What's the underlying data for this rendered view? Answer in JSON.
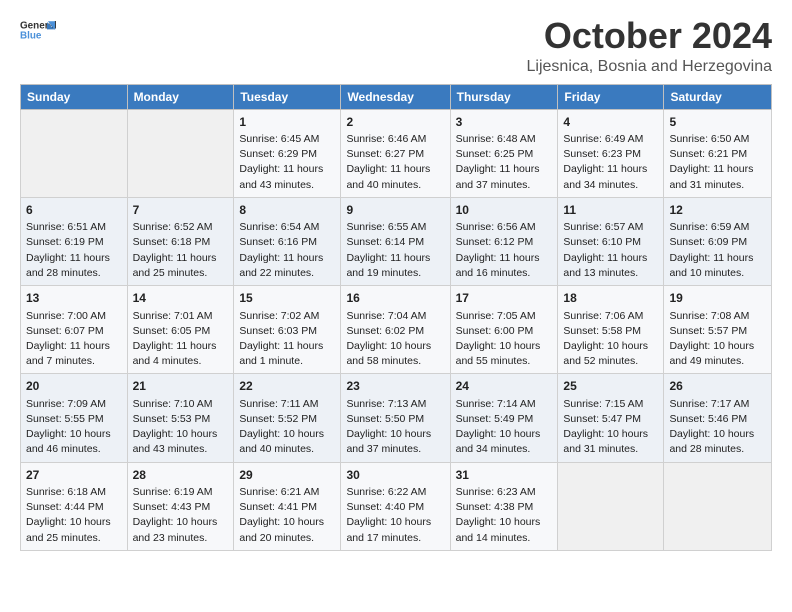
{
  "header": {
    "logo_general": "General",
    "logo_blue": "Blue",
    "month": "October 2024",
    "location": "Lijesnica, Bosnia and Herzegovina"
  },
  "weekdays": [
    "Sunday",
    "Monday",
    "Tuesday",
    "Wednesday",
    "Thursday",
    "Friday",
    "Saturday"
  ],
  "weeks": [
    [
      {
        "day": "",
        "sunrise": "",
        "sunset": "",
        "daylight": ""
      },
      {
        "day": "",
        "sunrise": "",
        "sunset": "",
        "daylight": ""
      },
      {
        "day": "1",
        "sunrise": "Sunrise: 6:45 AM",
        "sunset": "Sunset: 6:29 PM",
        "daylight": "Daylight: 11 hours and 43 minutes."
      },
      {
        "day": "2",
        "sunrise": "Sunrise: 6:46 AM",
        "sunset": "Sunset: 6:27 PM",
        "daylight": "Daylight: 11 hours and 40 minutes."
      },
      {
        "day": "3",
        "sunrise": "Sunrise: 6:48 AM",
        "sunset": "Sunset: 6:25 PM",
        "daylight": "Daylight: 11 hours and 37 minutes."
      },
      {
        "day": "4",
        "sunrise": "Sunrise: 6:49 AM",
        "sunset": "Sunset: 6:23 PM",
        "daylight": "Daylight: 11 hours and 34 minutes."
      },
      {
        "day": "5",
        "sunrise": "Sunrise: 6:50 AM",
        "sunset": "Sunset: 6:21 PM",
        "daylight": "Daylight: 11 hours and 31 minutes."
      }
    ],
    [
      {
        "day": "6",
        "sunrise": "Sunrise: 6:51 AM",
        "sunset": "Sunset: 6:19 PM",
        "daylight": "Daylight: 11 hours and 28 minutes."
      },
      {
        "day": "7",
        "sunrise": "Sunrise: 6:52 AM",
        "sunset": "Sunset: 6:18 PM",
        "daylight": "Daylight: 11 hours and 25 minutes."
      },
      {
        "day": "8",
        "sunrise": "Sunrise: 6:54 AM",
        "sunset": "Sunset: 6:16 PM",
        "daylight": "Daylight: 11 hours and 22 minutes."
      },
      {
        "day": "9",
        "sunrise": "Sunrise: 6:55 AM",
        "sunset": "Sunset: 6:14 PM",
        "daylight": "Daylight: 11 hours and 19 minutes."
      },
      {
        "day": "10",
        "sunrise": "Sunrise: 6:56 AM",
        "sunset": "Sunset: 6:12 PM",
        "daylight": "Daylight: 11 hours and 16 minutes."
      },
      {
        "day": "11",
        "sunrise": "Sunrise: 6:57 AM",
        "sunset": "Sunset: 6:10 PM",
        "daylight": "Daylight: 11 hours and 13 minutes."
      },
      {
        "day": "12",
        "sunrise": "Sunrise: 6:59 AM",
        "sunset": "Sunset: 6:09 PM",
        "daylight": "Daylight: 11 hours and 10 minutes."
      }
    ],
    [
      {
        "day": "13",
        "sunrise": "Sunrise: 7:00 AM",
        "sunset": "Sunset: 6:07 PM",
        "daylight": "Daylight: 11 hours and 7 minutes."
      },
      {
        "day": "14",
        "sunrise": "Sunrise: 7:01 AM",
        "sunset": "Sunset: 6:05 PM",
        "daylight": "Daylight: 11 hours and 4 minutes."
      },
      {
        "day": "15",
        "sunrise": "Sunrise: 7:02 AM",
        "sunset": "Sunset: 6:03 PM",
        "daylight": "Daylight: 11 hours and 1 minute."
      },
      {
        "day": "16",
        "sunrise": "Sunrise: 7:04 AM",
        "sunset": "Sunset: 6:02 PM",
        "daylight": "Daylight: 10 hours and 58 minutes."
      },
      {
        "day": "17",
        "sunrise": "Sunrise: 7:05 AM",
        "sunset": "Sunset: 6:00 PM",
        "daylight": "Daylight: 10 hours and 55 minutes."
      },
      {
        "day": "18",
        "sunrise": "Sunrise: 7:06 AM",
        "sunset": "Sunset: 5:58 PM",
        "daylight": "Daylight: 10 hours and 52 minutes."
      },
      {
        "day": "19",
        "sunrise": "Sunrise: 7:08 AM",
        "sunset": "Sunset: 5:57 PM",
        "daylight": "Daylight: 10 hours and 49 minutes."
      }
    ],
    [
      {
        "day": "20",
        "sunrise": "Sunrise: 7:09 AM",
        "sunset": "Sunset: 5:55 PM",
        "daylight": "Daylight: 10 hours and 46 minutes."
      },
      {
        "day": "21",
        "sunrise": "Sunrise: 7:10 AM",
        "sunset": "Sunset: 5:53 PM",
        "daylight": "Daylight: 10 hours and 43 minutes."
      },
      {
        "day": "22",
        "sunrise": "Sunrise: 7:11 AM",
        "sunset": "Sunset: 5:52 PM",
        "daylight": "Daylight: 10 hours and 40 minutes."
      },
      {
        "day": "23",
        "sunrise": "Sunrise: 7:13 AM",
        "sunset": "Sunset: 5:50 PM",
        "daylight": "Daylight: 10 hours and 37 minutes."
      },
      {
        "day": "24",
        "sunrise": "Sunrise: 7:14 AM",
        "sunset": "Sunset: 5:49 PM",
        "daylight": "Daylight: 10 hours and 34 minutes."
      },
      {
        "day": "25",
        "sunrise": "Sunrise: 7:15 AM",
        "sunset": "Sunset: 5:47 PM",
        "daylight": "Daylight: 10 hours and 31 minutes."
      },
      {
        "day": "26",
        "sunrise": "Sunrise: 7:17 AM",
        "sunset": "Sunset: 5:46 PM",
        "daylight": "Daylight: 10 hours and 28 minutes."
      }
    ],
    [
      {
        "day": "27",
        "sunrise": "Sunrise: 6:18 AM",
        "sunset": "Sunset: 4:44 PM",
        "daylight": "Daylight: 10 hours and 25 minutes."
      },
      {
        "day": "28",
        "sunrise": "Sunrise: 6:19 AM",
        "sunset": "Sunset: 4:43 PM",
        "daylight": "Daylight: 10 hours and 23 minutes."
      },
      {
        "day": "29",
        "sunrise": "Sunrise: 6:21 AM",
        "sunset": "Sunset: 4:41 PM",
        "daylight": "Daylight: 10 hours and 20 minutes."
      },
      {
        "day": "30",
        "sunrise": "Sunrise: 6:22 AM",
        "sunset": "Sunset: 4:40 PM",
        "daylight": "Daylight: 10 hours and 17 minutes."
      },
      {
        "day": "31",
        "sunrise": "Sunrise: 6:23 AM",
        "sunset": "Sunset: 4:38 PM",
        "daylight": "Daylight: 10 hours and 14 minutes."
      },
      {
        "day": "",
        "sunrise": "",
        "sunset": "",
        "daylight": ""
      },
      {
        "day": "",
        "sunrise": "",
        "sunset": "",
        "daylight": ""
      }
    ]
  ]
}
